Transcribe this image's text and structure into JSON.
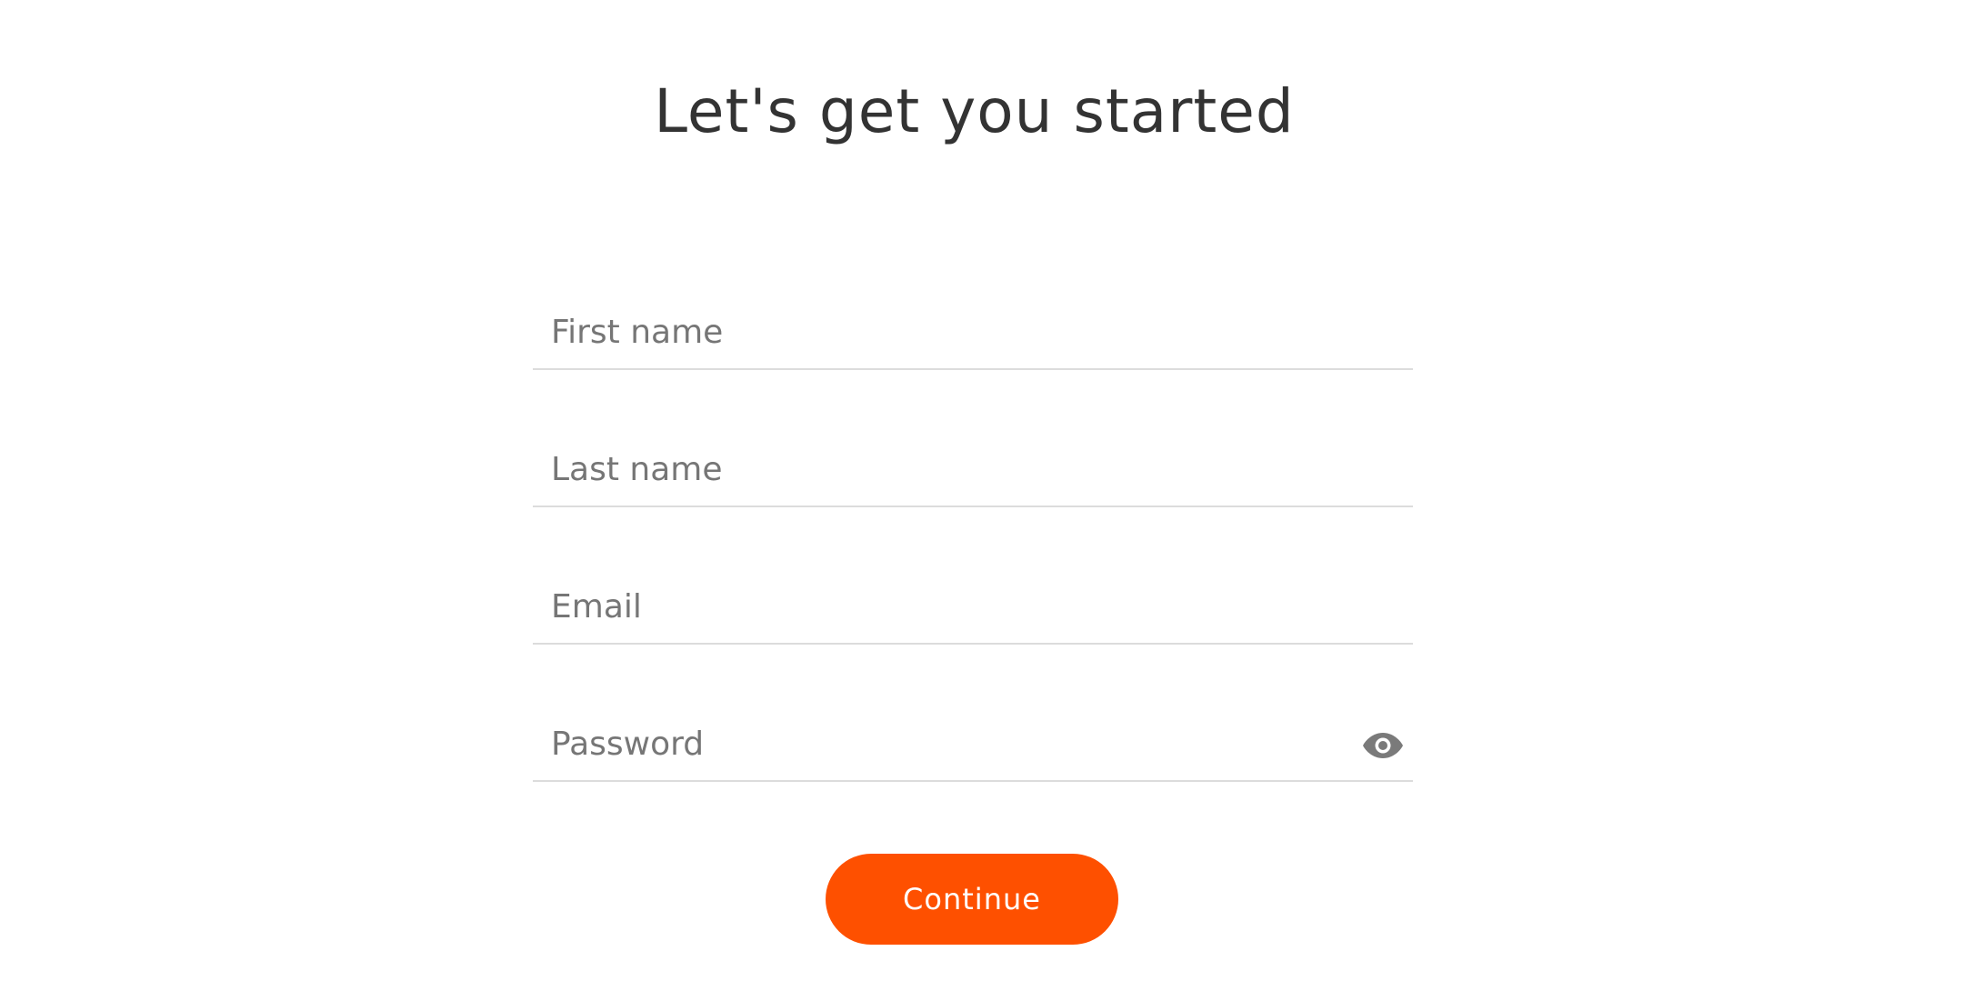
{
  "page": {
    "title": "Let's get you started"
  },
  "form": {
    "first_name": {
      "value": "",
      "placeholder": "First name"
    },
    "last_name": {
      "value": "",
      "placeholder": "Last name"
    },
    "email": {
      "value": "",
      "placeholder": "Email"
    },
    "password": {
      "value": "",
      "placeholder": "Password",
      "toggle_icon": "eye-icon"
    }
  },
  "actions": {
    "continue_label": "Continue"
  },
  "colors": {
    "accent": "#fe5000",
    "title_text": "#333333",
    "placeholder_text": "#767676",
    "divider": "#dcdcdc",
    "icon": "#7a7a7a"
  }
}
